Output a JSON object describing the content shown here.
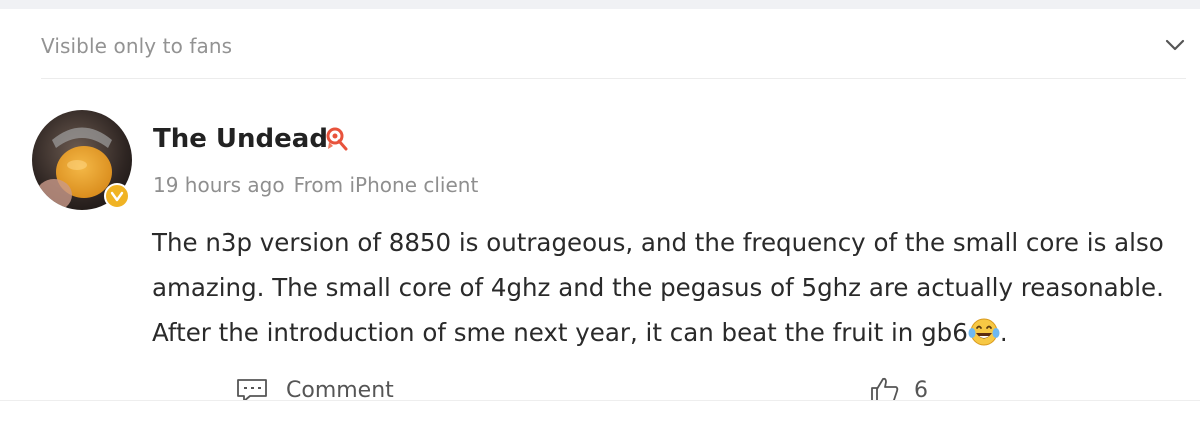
{
  "visibility": {
    "label": "Visible only to fans",
    "toggle_icon": "chevron-down-icon"
  },
  "post": {
    "author": {
      "name": "The Undead",
      "avatar_icon": "avatar",
      "verified_icon": "verified-badge-icon",
      "level_icon": "user-level-icon"
    },
    "time": "19 hours ago",
    "source": "From iPhone client",
    "body": {
      "line1": "The n3p version of 8850 is outrageous, and the frequency of the small core is also",
      "line2": "amazing. The small core of 4ghz and the pegasus of 5ghz are actually reasonable.",
      "line3": "After the introduction of sme next year, it can beat the fruit in gb6",
      "line3_end": ".",
      "emoji": "laughing-tears-emoji"
    },
    "actions": {
      "comment_label": "Comment",
      "comment_icon": "comment-icon",
      "like_icon": "thumbs-up-icon",
      "like_count": "6"
    }
  },
  "colors": {
    "text_primary": "#2a2a2a",
    "text_meta": "#8f8f8f",
    "badge": "#f0b324",
    "level": "#e8533c"
  }
}
